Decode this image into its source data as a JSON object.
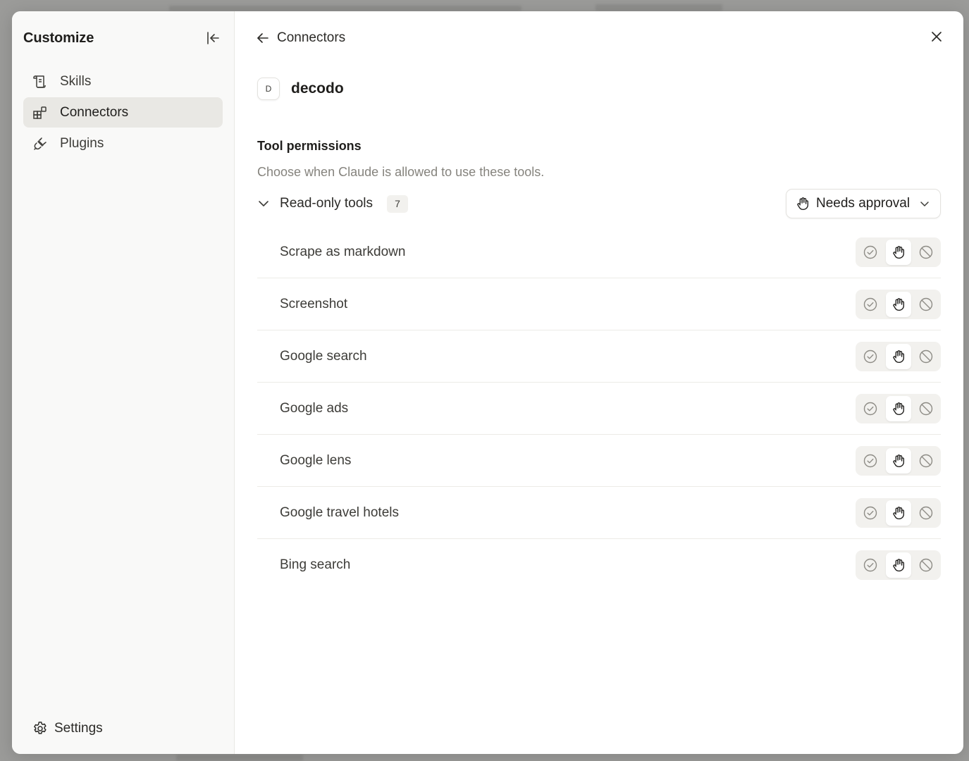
{
  "sidebar": {
    "title": "Customize",
    "items": [
      {
        "label": "Skills",
        "icon": "scroll-icon",
        "active": false
      },
      {
        "label": "Connectors",
        "icon": "connectors-icon",
        "active": true
      },
      {
        "label": "Plugins",
        "icon": "plug-icon",
        "active": false
      }
    ],
    "settings_label": "Settings"
  },
  "main": {
    "back_label": "Connectors",
    "connector": {
      "logo_letter": "D",
      "name": "decodo"
    },
    "permissions": {
      "title": "Tool permissions",
      "description": "Choose when Claude is allowed to use these tools.",
      "group": {
        "label": "Read-only tools",
        "count": "7",
        "dropdown_value": "Needs approval"
      },
      "tools": [
        {
          "name": "Scrape as markdown",
          "selected": "needs-approval"
        },
        {
          "name": "Screenshot",
          "selected": "needs-approval"
        },
        {
          "name": "Google search",
          "selected": "needs-approval"
        },
        {
          "name": "Google ads",
          "selected": "needs-approval"
        },
        {
          "name": "Google lens",
          "selected": "needs-approval"
        },
        {
          "name": "Google travel hotels",
          "selected": "needs-approval"
        },
        {
          "name": "Bing search",
          "selected": "needs-approval"
        }
      ]
    }
  }
}
